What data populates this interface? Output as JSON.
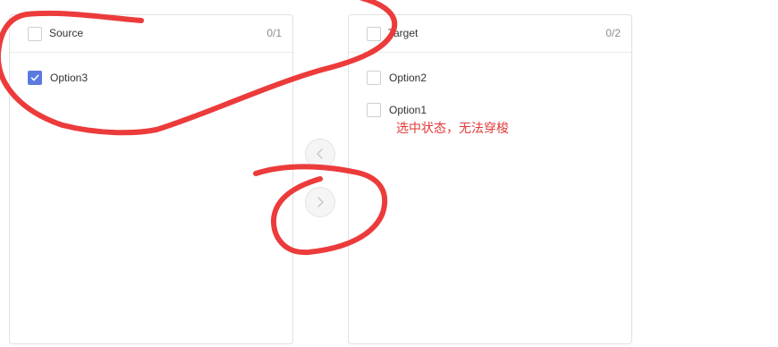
{
  "source": {
    "title": "Source",
    "count": "0/1",
    "items": [
      {
        "label": "Option3",
        "checked": true
      }
    ]
  },
  "target": {
    "title": "Target",
    "count": "0/2",
    "items": [
      {
        "label": "Option2",
        "checked": false
      },
      {
        "label": "Option1",
        "checked": false
      }
    ]
  },
  "transfer_buttons": {
    "to_left": {
      "icon": "chevron-left-icon",
      "disabled": true
    },
    "to_right": {
      "icon": "chevron-right-icon",
      "disabled": true
    }
  },
  "annotation": {
    "note": "选中状态，无法穿梭",
    "color": "#e23a3a"
  },
  "colors": {
    "accent": "#5b7ae0",
    "annotation_red": "#ec3b3b",
    "border": "#e0e0e0"
  }
}
